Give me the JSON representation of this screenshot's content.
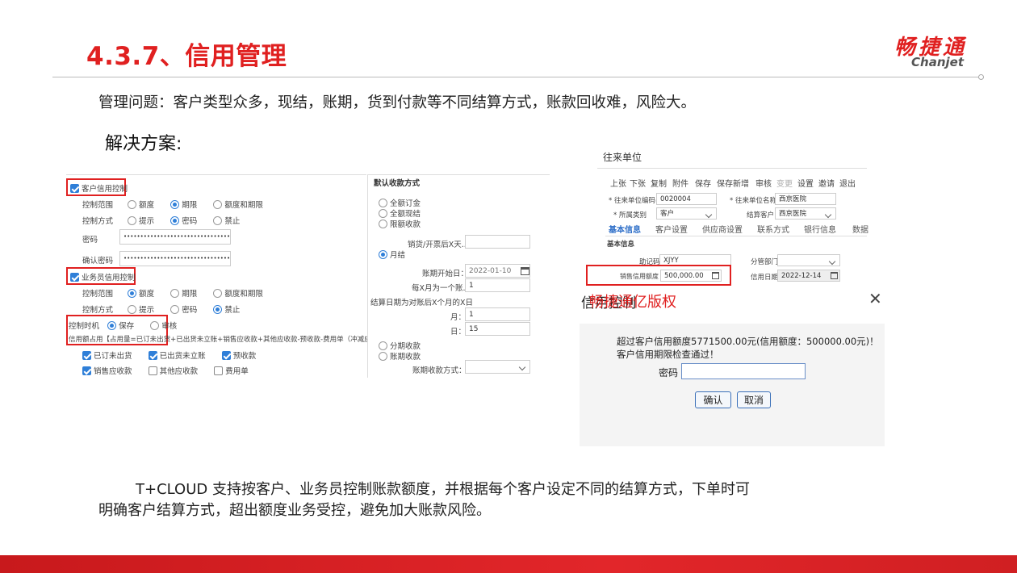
{
  "slide": {
    "title": "4.3.7、信用管理",
    "logo_cn": "畅捷通",
    "logo_en": "Chanjet",
    "problem": "管理问题：客户类型众多，现结，账期，货到付款等不同结算方式，账款回收难，风险大。",
    "solution_label": "解决方案:",
    "summary_line1": "T+CLOUD 支持按客户、业务员控制账款额度，并根据每个客户设定不同的结算方式，下单时可",
    "summary_line2": "明确客户结算方式，超出额度业务受控，避免加大账款风险。"
  },
  "credit_panel": {
    "customer_credit": "客户信用控制",
    "control_scope": "控制范围",
    "scope_opts": [
      "额度",
      "期限",
      "额度和期限"
    ],
    "control_mode": "控制方式",
    "mode_opts": [
      "提示",
      "密码",
      "禁止"
    ],
    "password_label": "密码",
    "password_value": "••••••••••••••••••••••••••••••••••",
    "confirm_password_label": "确认密码",
    "confirm_password_value": "••••••••••••••••••••••••••••••••••",
    "salesperson_credit": "业务员信用控制",
    "control_timing": "控制时机",
    "timing_opts": [
      "保存",
      "审核"
    ],
    "formula": "信用额占用【占用量=已订未出货+已出货未立账+销售应收款+其他应收款-预收款-费用单（冲减应",
    "items": [
      "已订未出货",
      "已出货未立账",
      "预收款",
      "销售应收款",
      "其他应收款",
      "费用单"
    ]
  },
  "payment_panel": {
    "header": "默认收款方式",
    "opts": [
      "全额订金",
      "全额现结",
      "限额收款"
    ],
    "days_after_label": "销货/开票后X天...",
    "monthly": "月结",
    "start_date_label": "账期开始日：",
    "start_date": "2022-01-10",
    "per_month_label": "每X月为一个账...",
    "per_month_value": "1",
    "settle_label": "结算日期为对账后X个月的X日",
    "month_label": "月：",
    "month_value": "1",
    "day_label": "日：",
    "day_value": "15",
    "installment": "分期收款",
    "account_period": "账期收款",
    "account_period_mode_label": "账期收款方式："
  },
  "partner_panel": {
    "title": "往来单位",
    "toolbar": [
      "上张",
      "下张",
      "复制",
      "附件",
      "保存",
      "保存新增",
      "审核",
      "变更",
      "设置",
      "邀请",
      "退出"
    ],
    "code_label": "* 往来单位编码",
    "code_value": "0020004",
    "name_label": "* 往来单位名称",
    "name_value": "西京医院",
    "category_label": "* 所属类别",
    "category_value": "客户",
    "settle_cust_label": "结算客户",
    "settle_cust_value": "西京医院",
    "tabs": [
      "基本信息",
      "客户设置",
      "供应商设置",
      "联系方式",
      "银行信息",
      "数据"
    ],
    "section": "基本信息",
    "mnemonic_label": "助记码",
    "mnemonic_value": "XJYY",
    "dept_label": "分管部门",
    "credit_label": "销售信用额度",
    "credit_value": "500,000.00",
    "expire_label": "信用日期",
    "expire_value": "2022-12-14"
  },
  "dialog": {
    "title": "信用控制",
    "watermark": "畅捷通亿版权",
    "message": "超过客户信用额度5771500.00元(信用额度：500000.00元)！客户信用期限检查通过！",
    "password_label": "密码",
    "ok": "确认",
    "cancel": "取消"
  }
}
